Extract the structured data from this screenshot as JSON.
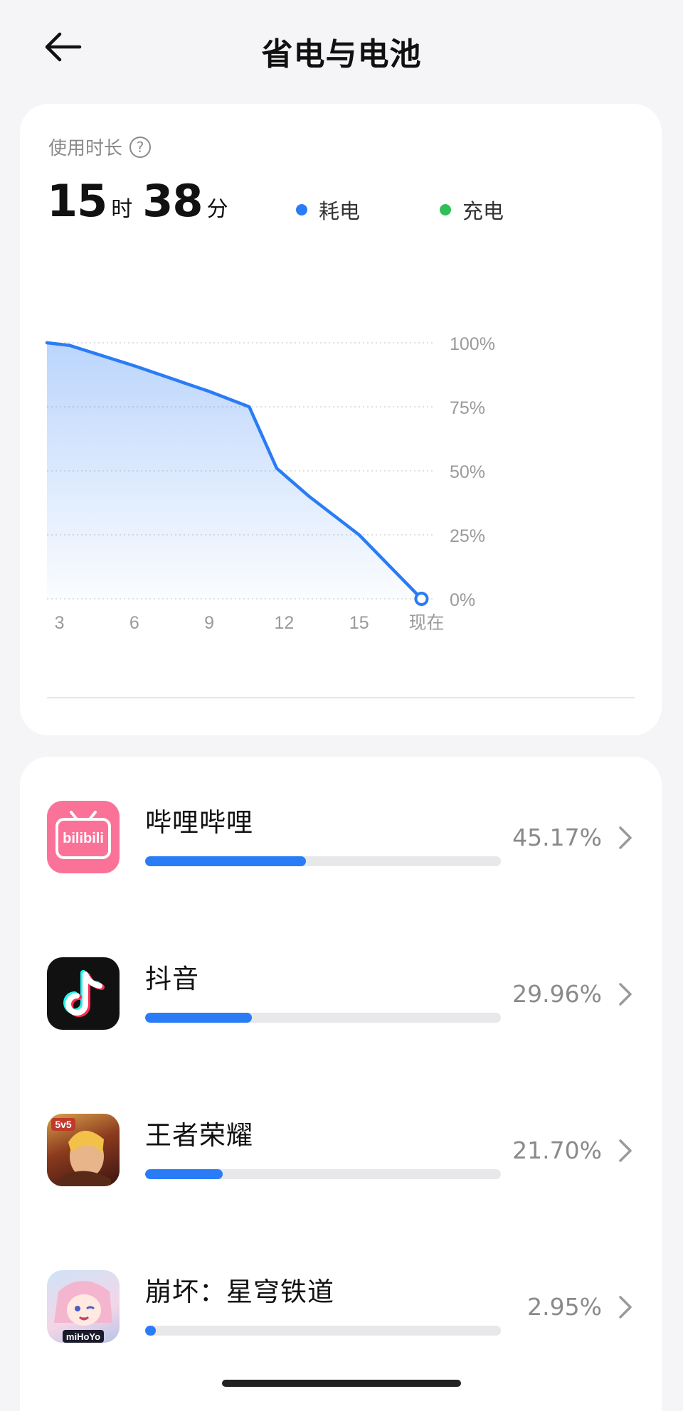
{
  "header": {
    "title": "省电与电池",
    "back_icon": "arrow-left-icon"
  },
  "usage": {
    "label": "使用时长",
    "hours": "15",
    "hours_unit": "时",
    "minutes": "38",
    "minutes_unit": "分",
    "legend": [
      {
        "label": "耗电",
        "color": "#2a7cf6"
      },
      {
        "label": "充电",
        "color": "#2fbf5a"
      }
    ]
  },
  "chart_data": {
    "type": "area",
    "x_ticks": [
      "3",
      "6",
      "9",
      "12",
      "15",
      "现在"
    ],
    "y_ticks": [
      "100%",
      "75%",
      "50%",
      "25%",
      "0%"
    ],
    "ylim": [
      0,
      100
    ],
    "series": [
      {
        "name": "耗电",
        "color": "#2a7cf6",
        "points": [
          {
            "x": 2.5,
            "y": 100
          },
          {
            "x": 3.4,
            "y": 99
          },
          {
            "x": 6.0,
            "y": 91
          },
          {
            "x": 9.0,
            "y": 81
          },
          {
            "x": 10.6,
            "y": 75
          },
          {
            "x": 11.7,
            "y": 51
          },
          {
            "x": 13.0,
            "y": 40
          },
          {
            "x": 15.0,
            "y": 25
          },
          {
            "x": 17.5,
            "y": 0
          }
        ]
      }
    ],
    "x_range": [
      2.5,
      18.0
    ]
  },
  "apps": [
    {
      "name": "哔哩哔哩",
      "percent": "45.17%",
      "value": 45.17,
      "icon": "bilibili-icon"
    },
    {
      "name": "抖音",
      "percent": "29.96%",
      "value": 29.96,
      "icon": "douyin-icon"
    },
    {
      "name": "王者荣耀",
      "percent": "21.70%",
      "value": 21.7,
      "icon": "honor-of-kings-icon"
    },
    {
      "name": "崩坏：星穹铁道",
      "percent": "2.95%",
      "value": 2.95,
      "icon": "star-rail-icon"
    }
  ],
  "icon_texts": {
    "bilibili": "bilibili",
    "game1": "5v5",
    "game2": "miHoYo"
  },
  "colors": {
    "accent": "#2a7cf6",
    "charge": "#2fbf5a"
  }
}
